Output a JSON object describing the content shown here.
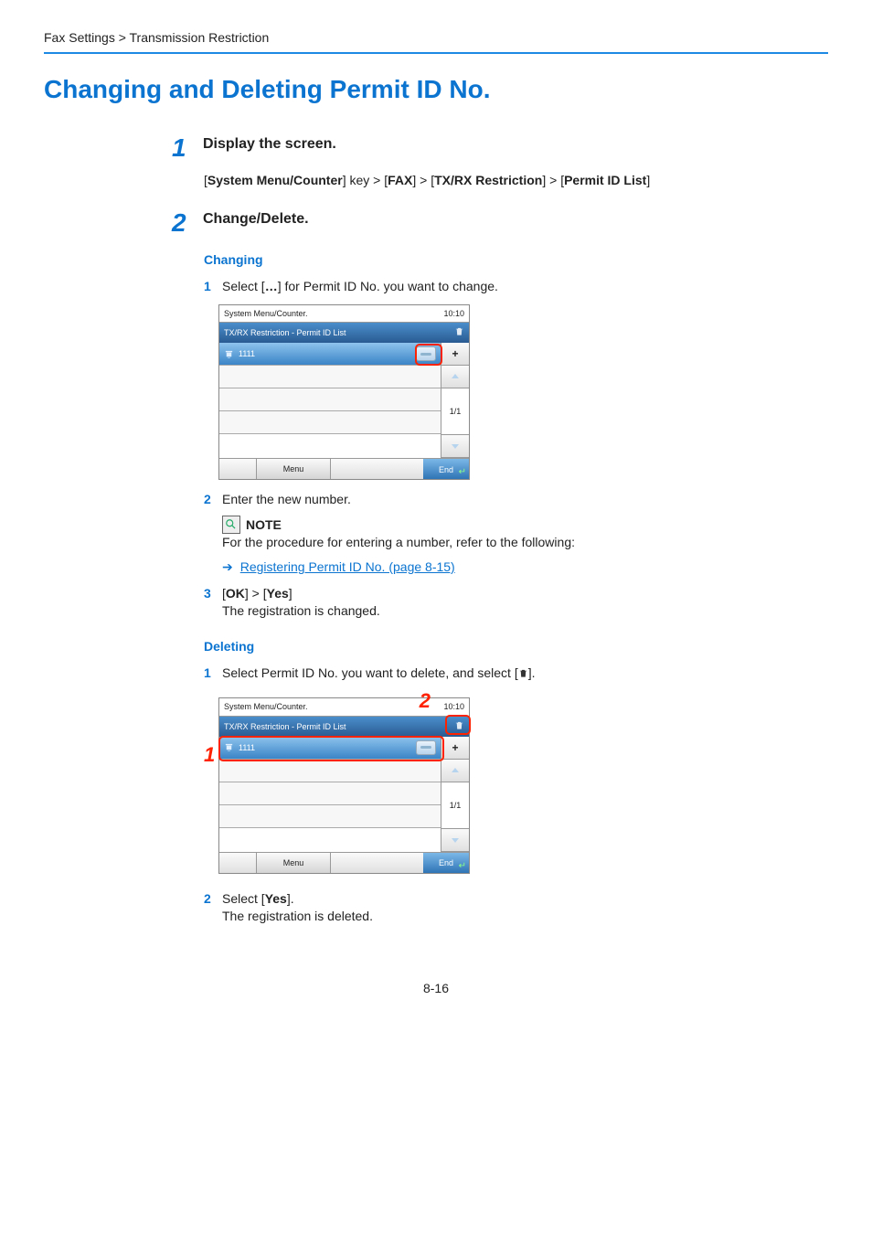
{
  "breadcrumb": "Fax Settings > Transmission Restriction",
  "title": "Changing and Deleting Permit ID No.",
  "step1": {
    "num": "1",
    "title": "Display the screen.",
    "path_parts": {
      "p1": "System Menu/Counter",
      "t1": "] key > [",
      "p2": "FAX",
      "t2": "] > [",
      "p3": "TX/RX Restriction",
      "t3": "] > [",
      "p4": "Permit ID List",
      "t4": "]"
    }
  },
  "step2": {
    "num": "2",
    "title": "Change/Delete.",
    "changing_heading": "Changing",
    "changing_sub1_num": "1",
    "changing_sub1_prefix": "Select [",
    "changing_sub1_bold": "…",
    "changing_sub1_suffix": "] for Permit ID No. you want to change.",
    "changing_sub2_num": "2",
    "changing_sub2": "Enter the new number.",
    "note_label": "NOTE",
    "note_text": "For the procedure for entering a number, refer to the following:",
    "ref_link_text": "Registering Permit ID No. (page 8-15)",
    "changing_sub3_num": "3",
    "changing_sub3_prefix": "[",
    "changing_sub3_ok": "OK",
    "changing_sub3_mid": "] > [",
    "changing_sub3_yes": "Yes",
    "changing_sub3_suffix": "]",
    "changing_sub3_line2": "The registration is changed.",
    "deleting_heading": "Deleting",
    "deleting_sub1_num": "1",
    "deleting_sub1_prefix": "Select Permit ID No. you want to delete, and select [",
    "deleting_sub1_suffix": "].",
    "deleting_sub2_num": "2",
    "deleting_sub2_prefix": "Select [",
    "deleting_sub2_yes": "Yes",
    "deleting_sub2_suffix": "].",
    "deleting_sub2_line2": "The registration is deleted."
  },
  "screenshot": {
    "title": "System Menu/Counter.",
    "time": "10:10",
    "header": "TX/RX Restriction - Permit ID List",
    "row_value": "1111",
    "page": "1/1",
    "plus": "+",
    "menu": "Menu",
    "end": "End"
  },
  "callouts": {
    "one": "1",
    "two": "2"
  },
  "page_number": "8-16"
}
